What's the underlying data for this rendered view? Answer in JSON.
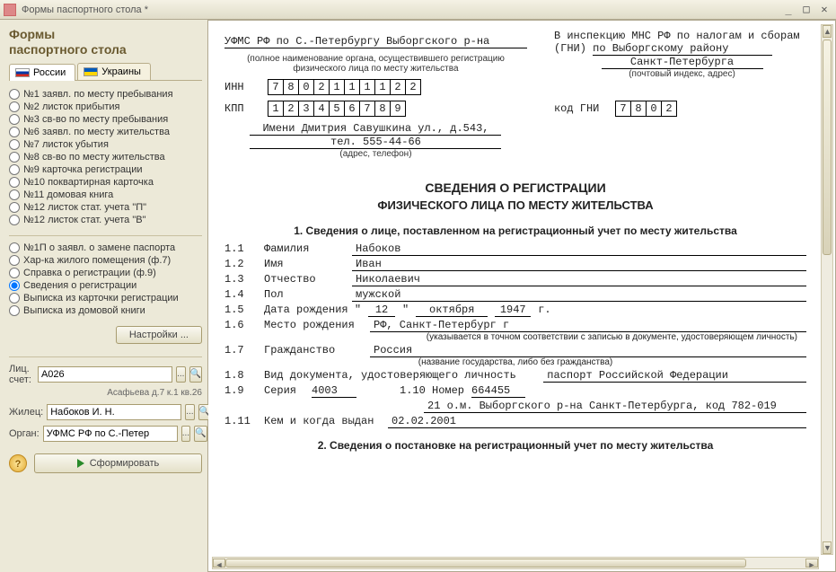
{
  "window": {
    "title": "Формы паспортного стола *"
  },
  "left": {
    "heading": "Формы\nпаспортного стола",
    "tabs": {
      "ru": "России",
      "ua": "Украины"
    },
    "group1": [
      "№1  заявл. по месту пребывания",
      "№2  листок прибытия",
      "№3  св-во по месту пребывания",
      "№6  заявл. по месту жительства",
      "№7  листок убытия",
      "№8  св-во по месту жительства",
      "№9  карточка регистрации",
      "№10 поквартирная карточка",
      "№11 домовая книга",
      "№12 листок стат. учета \"П\"",
      "№12 листок стат. учета \"В\""
    ],
    "group2": [
      "№1П  о заявл. о замене паспорта",
      "Хар-ка жилого помещения (ф.7)",
      "Справка о регистрации (ф.9)",
      "Сведения о регистрации",
      "Выписка из карточки регистрации",
      "Выписка из домовой книги"
    ],
    "selected": "Сведения о регистрации",
    "settings_btn": "Настройки ...",
    "fields": {
      "acct_label": "Лиц. счет:",
      "acct_value": "А026",
      "acct_note": "Асафьева д.7 к.1 кв.26",
      "tenant_label": "Жилец:",
      "tenant_value": "Набоков И. Н.",
      "org_label": "Орган:",
      "org_value": "УФМС РФ по С.-Петер"
    },
    "generate_btn": "Сформировать"
  },
  "doc": {
    "org_full": "УФМС РФ по С.-Петербургу Выборгского р-на",
    "org_caption": "(полное наименование органа, осуществившего регистрацию физического лица по месту жительства",
    "insp_line1": "В инспекцию МНС РФ по налогам и сборам",
    "insp_line2_lab": "(ГНИ)",
    "insp_line2_val": "по Выборгскому району",
    "insp_line3_val": "Санкт-Петербурга",
    "insp_caption": "(почтовый индекс, адрес)",
    "inn_lab": "ИНН",
    "inn": [
      "7",
      "8",
      "0",
      "2",
      "1",
      "1",
      "1",
      "1",
      "2",
      "2"
    ],
    "kpp_lab": "КПП",
    "kpp": [
      "1",
      "2",
      "3",
      "4",
      "5",
      "6",
      "7",
      "8",
      "9"
    ],
    "gni_lab": "код ГНИ",
    "gni": [
      "7",
      "8",
      "0",
      "2"
    ],
    "addr_line1": "Имени Дмитрия Савушкина ул., д.543,",
    "addr_line2": "тел. 555-44-66",
    "addr_caption": "(адрес, телефон)",
    "title": "СВЕДЕНИЯ О РЕГИСТРАЦИИ",
    "subtitle": "ФИЗИЧЕСКОГО ЛИЦА ПО МЕСТУ ЖИТЕЛЬСТВА",
    "sec1": "1. Сведения о лице, поставленном на регистрационный учет по месту жительства",
    "lines": {
      "l11_lab": "Фамилия",
      "l11_val": "Набоков",
      "l12_lab": "Имя",
      "l12_val": "Иван",
      "l13_lab": "Отчество",
      "l13_val": "Николаевич",
      "l14_lab": "Пол",
      "l14_val": "мужской",
      "l15_lab": "Дата рождения \"",
      "l15_d": "12",
      "l15_m": "октября",
      "l15_y": "1947",
      "l15_suf": "г.",
      "l16_lab": "Место рождения",
      "l16_val": "РФ, Санкт-Петербург г",
      "l16_note": "(указывается в точном соответствии с записью в документе, удостоверяющем личность)",
      "l17_lab": "Гражданство",
      "l17_val": "Россия",
      "l17_note": "(название государства, либо без гражданства)",
      "l18_lab": "Вид документа, удостоверяющего личность",
      "l18_val": "паспорт Российской Федерации",
      "l19_lab": "Серия",
      "l19_val": "4003",
      "l110_lab": "1.10 Номер",
      "l110_val": "664455",
      "l19b_val": "21 о.м. Выборгского р-на Санкт-Петербурга, код 782-019",
      "l111_lab": "Кем и когда выдан",
      "l111_val": "02.02.2001"
    },
    "sec2": "2. Сведения о постановке на регистрационный учет по месту жительства"
  }
}
